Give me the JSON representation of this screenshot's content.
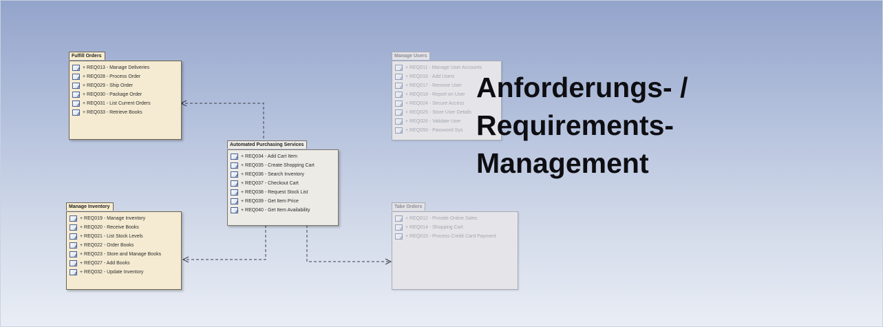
{
  "title": {
    "line1": "Anforderungs- /",
    "line2": "Requirements-",
    "line3": "Management"
  },
  "packages": {
    "fulfill": {
      "name": "Fulfill Orders",
      "items": [
        "+ REQ013 - Manage Deliveries",
        "+ REQ028 - Process Order",
        "+ REQ029 - Ship Order",
        "+ REQ030 - Package Order",
        "+ REQ031 - List Current Orders",
        "+ REQ033 - Retrieve Books"
      ]
    },
    "users": {
      "name": "Manage Users",
      "items": [
        "+ REQ011 - Manage User Accounts",
        "+ REQ016 - Add Users",
        "+ REQ017 - Remove User",
        "+ REQ018 - Report on User",
        "+ REQ024 - Secure Access",
        "+ REQ025 - Store User Details",
        "+ REQ026 - Validate User",
        "+ REQ050 - Password Sys"
      ]
    },
    "automated": {
      "name": "Automated Purchasing Services",
      "items": [
        "+ REQ034 - Add Cart Item",
        "+ REQ035 - Create Shopping Cart",
        "+ REQ036 - Search Inventory",
        "+ REQ037 - Checkout Cart",
        "+ REQ038 - Request Stock List",
        "+ REQ039 - Get Item Price",
        "+ REQ040 - Get Item Availability"
      ]
    },
    "inventory": {
      "name": "Manage Inventory",
      "items": [
        "+ REQ019 - Manage Inventory",
        "+ REQ020 - Receive Books",
        "+ REQ021 - List Stock Levels",
        "+ REQ022 - Order Books",
        "+ REQ023 - Store and Manage Books",
        "+ REQ027 - Add Books",
        "+ REQ032 - Update Inventory"
      ]
    },
    "orders": {
      "name": "Take Orders",
      "items": [
        "+ REQ012 - Provide Online Sales",
        "+ REQ014 - Shopping Cart",
        "+ REQ015 - Process Credit Card Payment"
      ]
    }
  },
  "colors": {
    "package_fill": "#f5ebd2",
    "package_faded": "#e5e5e9",
    "background_top": "#93a4cb",
    "background_bottom": "#e9edf5",
    "title": "#0e0e12"
  },
  "icons": [
    "requirement-icon"
  ]
}
